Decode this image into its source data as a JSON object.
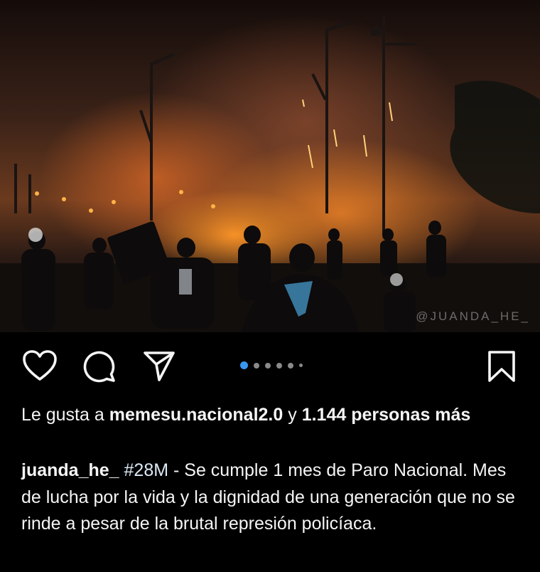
{
  "post": {
    "watermark": "@JUANDA_HE_",
    "likes": {
      "prefix": "Le gusta a",
      "user": "memesu.nacional2.0",
      "joiner": "y",
      "count_text": "1.144 personas más"
    },
    "caption": {
      "username": "juanda_he_",
      "hashtag": "#28M",
      "text": " - Se cumple 1 mes de Paro Nacional. Mes de lucha por la vida y la dignidad de una generación que no se rinde a pesar de la brutal represión policíaca."
    },
    "carousel": {
      "total": 6,
      "active_index": 0
    },
    "icons": [
      "heart-icon",
      "comment-icon",
      "share-icon",
      "bookmark-icon"
    ],
    "colors": {
      "background": "#000000",
      "active_dot": "#3897f0",
      "text": "#f5f5f5"
    }
  }
}
